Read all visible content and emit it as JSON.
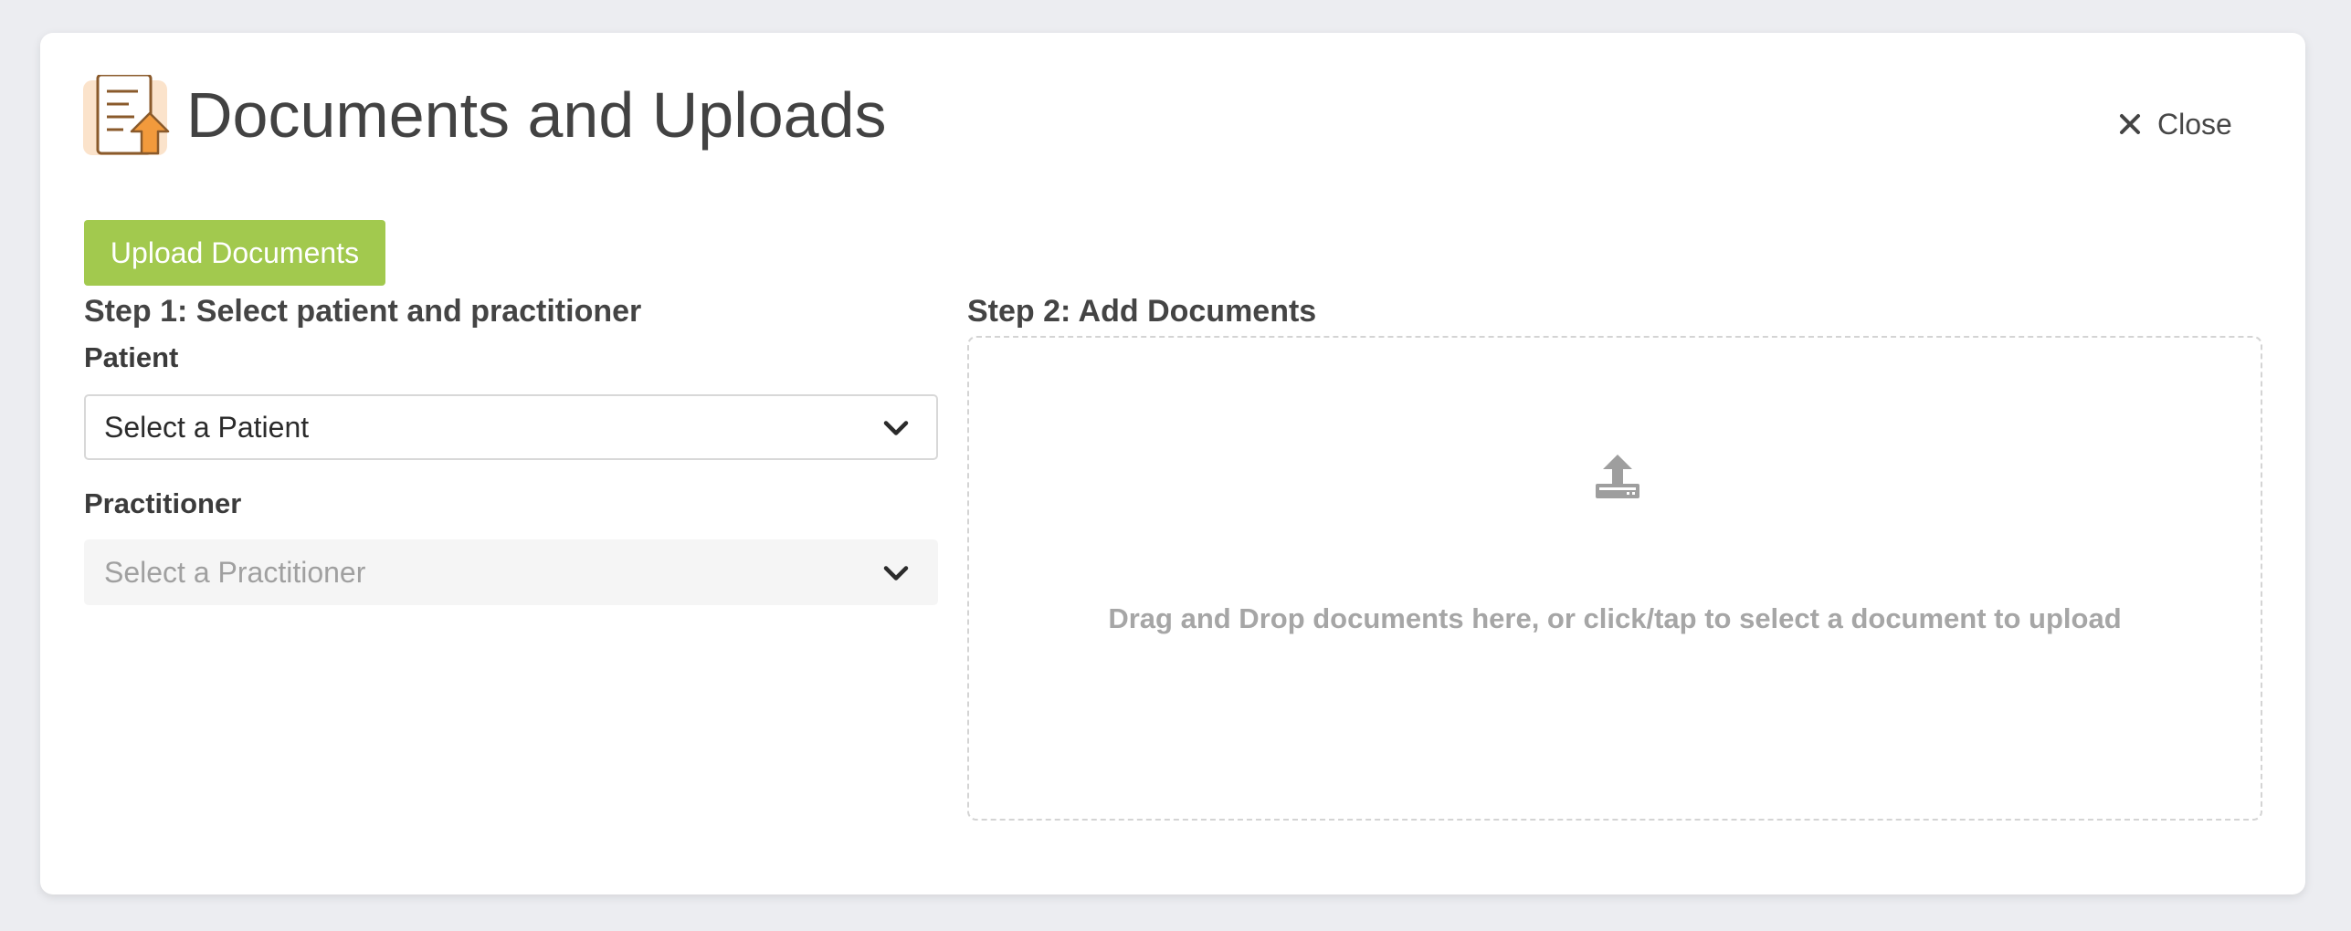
{
  "header": {
    "title": "Documents and Uploads",
    "close_label": "Close",
    "icon": "document-upload-icon"
  },
  "toolbar": {
    "upload_label": "Upload Documents"
  },
  "step1": {
    "heading": "Step 1: Select patient and practitioner",
    "patient_label": "Patient",
    "patient_select_value": "Select a Patient",
    "practitioner_label": "Practitioner",
    "practitioner_select_value": "Select a Practitioner"
  },
  "step2": {
    "heading": "Step 2: Add Documents",
    "dropzone_text": "Drag and Drop documents here, or click/tap to select a document to upload",
    "dropzone_icon": "upload-icon"
  },
  "colors": {
    "accent_green": "#a2c94e",
    "title_text": "#424242",
    "muted_text": "#a6a6a6",
    "icon_orange": "#f29a3c",
    "icon_bg": "#fbe3cb"
  }
}
